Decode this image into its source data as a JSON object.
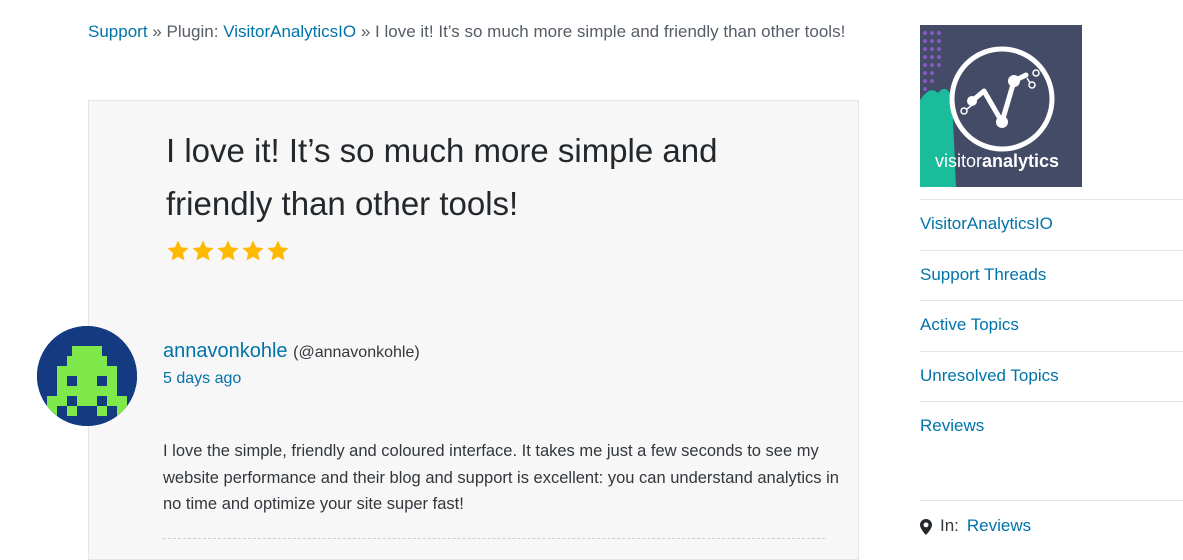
{
  "breadcrumb": {
    "support": "Support",
    "sep1": "»",
    "plugin_prefix": "Plugin:",
    "plugin_name": "VisitorAnalyticsIO",
    "sep2": "»",
    "current": "I love it! It’s so much more simple and friendly than other tools!"
  },
  "review": {
    "title": "I love it! It’s so much more simple and friendly than other tools!",
    "rating": 5,
    "rating_max": 5,
    "star_color": "#ffb900",
    "author_name": "annavonkohle",
    "author_handle": "(@annavonkohle)",
    "date": "5 days ago",
    "body": "I love the simple, friendly and coloured interface. It takes me just a few seconds to see my website performance and their blog and support is excellent: you can understand analytics in no time and optimize your site super fast!"
  },
  "sidebar": {
    "banner_text": {
      "light": "visitor",
      "bold": "analytics"
    },
    "links": [
      {
        "label": "VisitorAnalyticsIO"
      },
      {
        "label": "Support Threads"
      },
      {
        "label": "Active Topics"
      },
      {
        "label": "Unresolved Topics"
      },
      {
        "label": "Reviews"
      }
    ],
    "meta_prefix": "In:",
    "meta_link": "Reviews"
  },
  "colors": {
    "link": "#0073aa",
    "banner_bg": "#434b66",
    "banner_teal": "#1abc9c",
    "avatar_bg": "#143a82",
    "avatar_fg": "#7fe84a"
  }
}
